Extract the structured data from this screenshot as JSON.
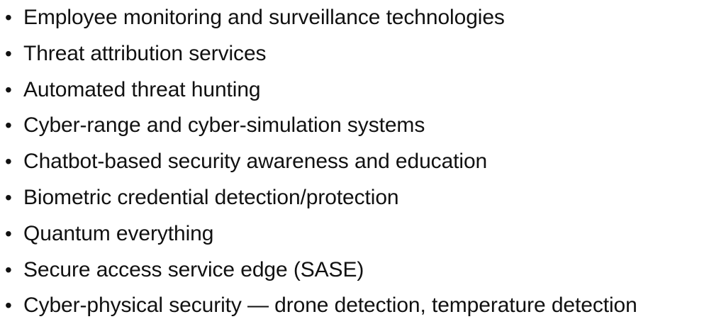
{
  "bullets": [
    {
      "marker": "•",
      "text": "Employee monitoring and surveillance technologies"
    },
    {
      "marker": "•",
      "text": "Threat attribution services"
    },
    {
      "marker": "•",
      "text": "Automated threat hunting"
    },
    {
      "marker": "•",
      "text": "Cyber-range and cyber-simulation systems"
    },
    {
      "marker": "•",
      "text": "Chatbot-based security awareness and education"
    },
    {
      "marker": "•",
      "text": "Biometric credential detection/protection"
    },
    {
      "marker": "•",
      "text": "Quantum everything"
    },
    {
      "marker": "•",
      "text": "Secure access service edge (SASE)"
    },
    {
      "marker": "•",
      "text": "Cyber-physical security — drone detection, temperature detection"
    }
  ]
}
